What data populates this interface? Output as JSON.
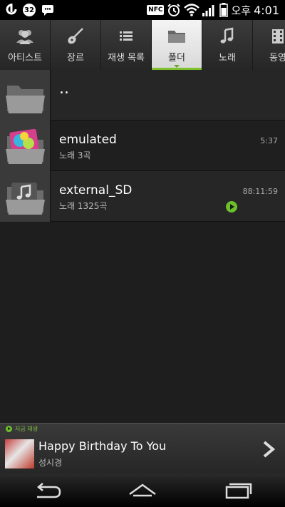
{
  "status_bar": {
    "notification_count": "32",
    "nfc_label": "NFC",
    "ampm": "오후",
    "time": "4:01",
    "icons": [
      "carrier-icon",
      "notification-badge",
      "messenger-icon",
      "nfc-icon",
      "alarm-icon",
      "wifi-icon",
      "signal-icon",
      "battery-icon"
    ]
  },
  "tabs": [
    {
      "label": "아티스트",
      "icon": "artist-icon"
    },
    {
      "label": "장르",
      "icon": "guitar-icon"
    },
    {
      "label": "재생 목록",
      "icon": "playlist-icon"
    },
    {
      "label": "폴더",
      "icon": "folder-icon",
      "active": true
    },
    {
      "label": "노래",
      "icon": "music-note-icon"
    },
    {
      "label": "동영",
      "icon": "video-icon"
    }
  ],
  "folders": [
    {
      "title": "..",
      "subtitle": "",
      "duration": ""
    },
    {
      "title": "emulated",
      "subtitle": "노래 3곡",
      "duration": "5:37"
    },
    {
      "title": "external_SD",
      "subtitle": "노래 1325곡",
      "duration": "88:11:59",
      "playing": true
    }
  ],
  "mini_player": {
    "now_playing_label": "지금 재생",
    "title": "Happy Birthday To You",
    "artist": "성시경"
  },
  "colors": {
    "accent": "#6cbf2a",
    "background": "#1e1e1e"
  }
}
